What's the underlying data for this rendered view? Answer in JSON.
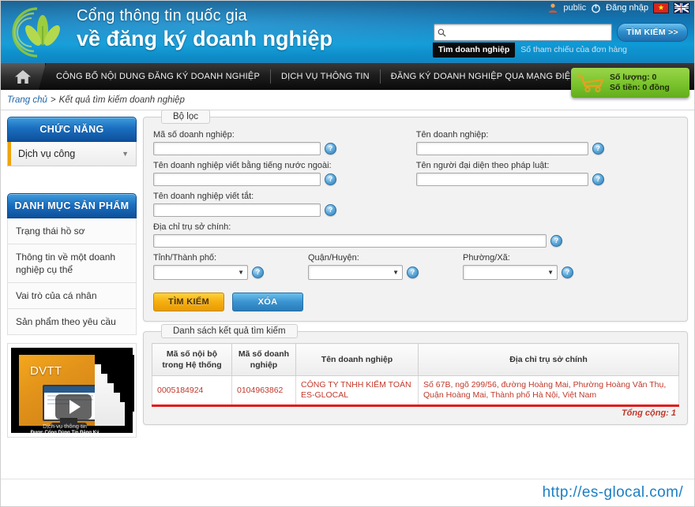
{
  "header": {
    "brand_line1": "Cổng thông tin quốc gia",
    "brand_line2": "về đăng ký doanh nghiệp",
    "user_name": "public",
    "login_label": "Đăng nhập",
    "flag_vn": "vietnam-flag",
    "flag_uk": "uk-flag",
    "search_value": "",
    "search_placeholder": "",
    "search_button": "TÌM KIẾM >>",
    "tab_active": "Tìm doanh nghiệp",
    "tab_inactive": "Số tham chiếu của đơn hàng"
  },
  "nav": {
    "home_icon": "home-icon",
    "items": [
      "CÔNG BỐ NỘI DUNG ĐĂNG KÝ DOANH NGHIỆP",
      "DỊCH VỤ THÔNG TIN",
      "ĐĂNG KÝ DOANH NGHIỆP QUA MẠNG ĐIỆN TỬ"
    ]
  },
  "cart": {
    "quantity_label": "Số lượng: 0",
    "amount_label": "Số tiền: 0 đồng",
    "color": "#7ac42e"
  },
  "breadcrumb": {
    "home": "Trang chủ",
    "separator": ">",
    "current": "Kết quả tìm kiếm doanh nghiệp"
  },
  "sidebar": {
    "functions_title": "CHỨC NĂNG",
    "functions_selected": "Dịch vụ công",
    "catalog_title": "DANH MỤC SẢN PHẨM",
    "catalog_items": [
      "Trạng thái hồ sơ",
      "Thông tin về một doanh nghiệp cụ thể",
      "Vai trò của cá nhân",
      "Sản phẩm theo yêu cầu"
    ],
    "video": {
      "badge": "DVTT",
      "caption1": "Dịch vụ thông tin",
      "caption2": "Được Cổng Dùng Tin Đăng Ký Doanh Nghiệp"
    }
  },
  "filter": {
    "legend": "Bộ lọc",
    "fields": {
      "enterprise_code_label": "Mã số doanh nghiệp:",
      "enterprise_code_value": "",
      "enterprise_name_label": "Tên doanh nghiệp:",
      "enterprise_name_value": "",
      "foreign_name_label": "Tên doanh nghiệp viết bằng tiếng nước ngoài:",
      "foreign_name_value": "",
      "legal_rep_label": "Tên người đại diện theo pháp luật:",
      "legal_rep_value": "",
      "short_name_label": "Tên doanh nghiệp viết tắt:",
      "short_name_value": "",
      "address_label": "Địa chỉ trụ sở chính:",
      "address_value": "",
      "province_label": "Tỉnh/Thành phố:",
      "province_value": "",
      "district_label": "Quận/Huyện:",
      "district_value": "",
      "ward_label": "Phường/Xã:",
      "ward_value": ""
    },
    "help_icon": "help-icon",
    "search_button": "TÌM KIẾM",
    "clear_button": "XÓA"
  },
  "results": {
    "legend": "Danh sách kết quả tìm kiếm",
    "columns": [
      "Mã số nội bộ trong Hệ thống",
      "Mã số doanh nghiệp",
      "Tên doanh nghiệp",
      "Địa chỉ trụ sở chính"
    ],
    "rows": [
      {
        "internal_code": "0005184924",
        "enterprise_code": "0104963862",
        "name": "CÔNG TY TNHH KIỂM TOÁN ES-GLOCAL",
        "address": "Số 67B, ngõ 299/56, đường Hoàng Mai, Phường Hoàng Văn Thụ, Quận Hoàng Mai, Thành phố Hà Nội, Việt Nam"
      }
    ],
    "total_label": "Tổng cộng: 1",
    "accent_color": "#e01b1b"
  },
  "watermark": "http://es-glocal.com/"
}
